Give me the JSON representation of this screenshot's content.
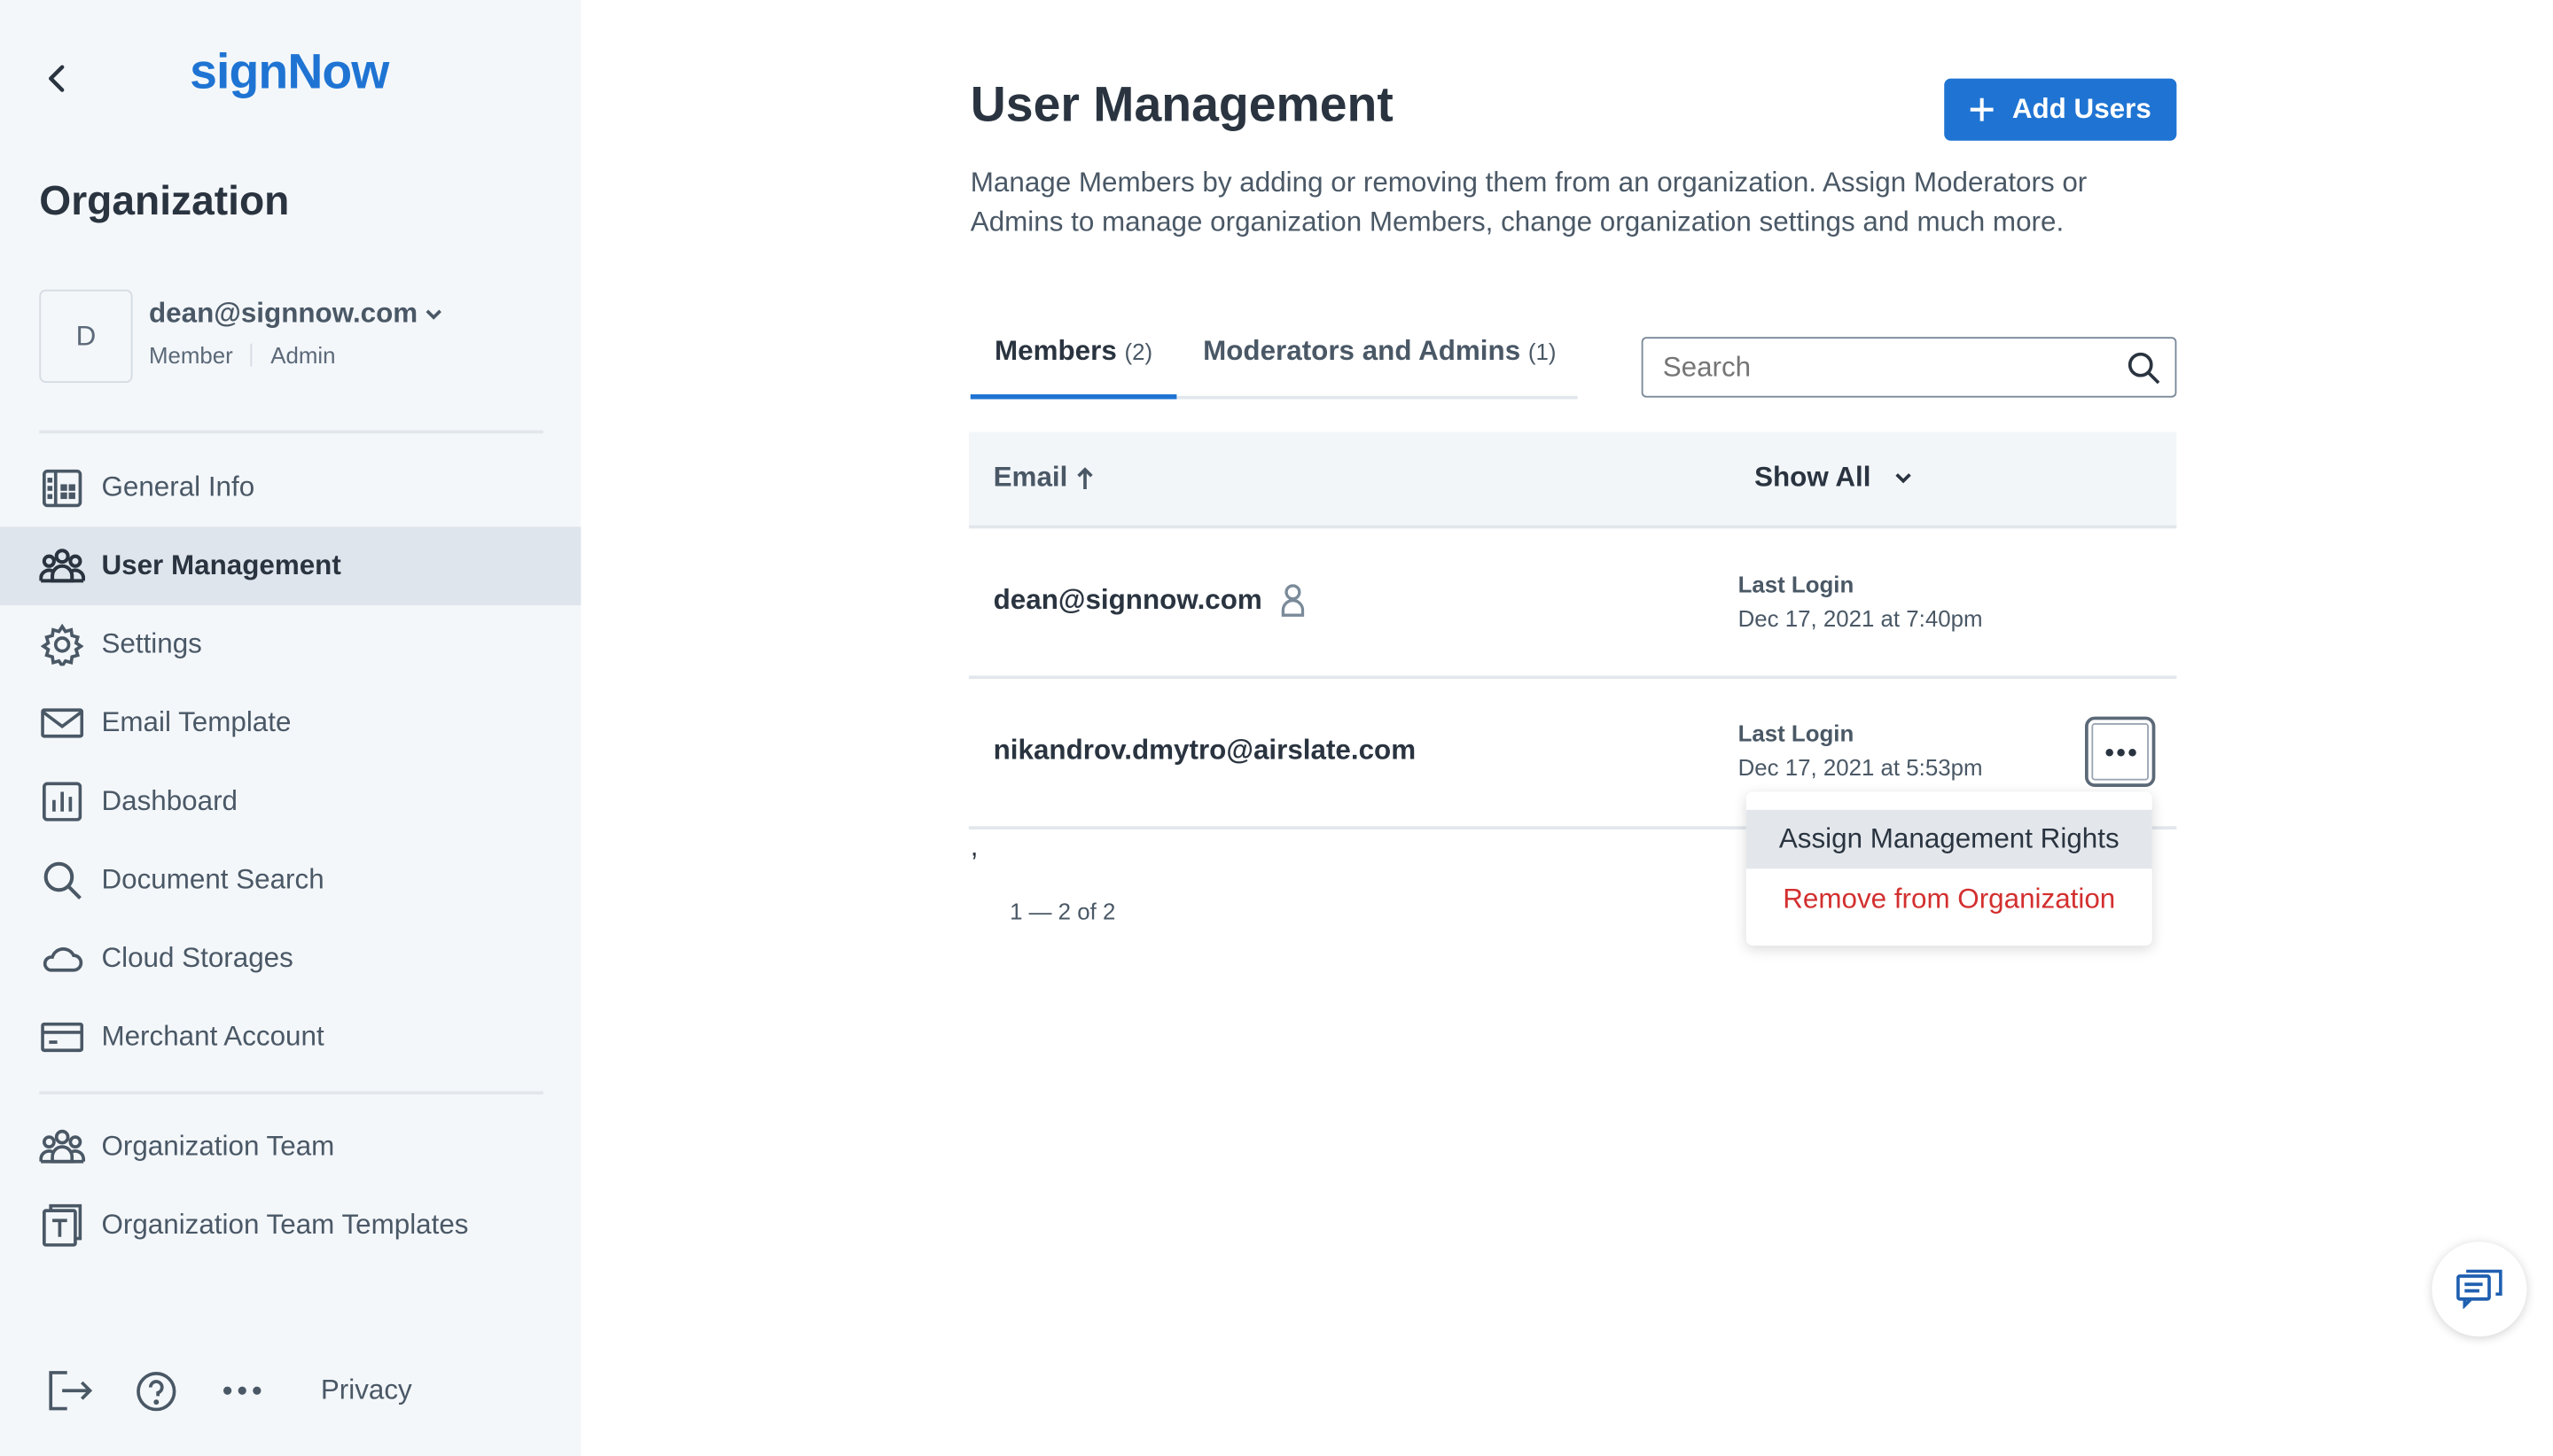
{
  "sidebar": {
    "logo": "signNow",
    "section_title": "Organization",
    "account": {
      "avatar_letter": "D",
      "email": "dean@signnow.com",
      "role_1": "Member",
      "role_2": "Admin"
    },
    "items": [
      {
        "label": "General Info",
        "icon": "building-icon"
      },
      {
        "label": "User Management",
        "icon": "users-icon",
        "active": true
      },
      {
        "label": "Settings",
        "icon": "gear-icon"
      },
      {
        "label": "Email Template",
        "icon": "envelope-icon"
      },
      {
        "label": "Dashboard",
        "icon": "bar-chart-icon"
      },
      {
        "label": "Document Search",
        "icon": "search-icon"
      },
      {
        "label": "Cloud Storages",
        "icon": "cloud-icon"
      },
      {
        "label": "Merchant Account",
        "icon": "credit-card-icon"
      }
    ],
    "team_items": [
      {
        "label": "Organization Team",
        "icon": "users-icon"
      },
      {
        "label": "Organization Team Templates",
        "icon": "template-icon"
      }
    ],
    "footer": {
      "privacy": "Privacy"
    }
  },
  "main": {
    "title": "User Management",
    "add_users": "Add Users",
    "description_line1": "Manage Members by adding or removing them from an organization. Assign Moderators or",
    "description_line2": "Admins to manage organization Members, change organization settings and much more.",
    "tabs": [
      {
        "label": "Members",
        "count": "(2)",
        "active": true
      },
      {
        "label": "Moderators and Admins",
        "count": "(1)"
      }
    ],
    "search": {
      "placeholder": "Search",
      "value": ""
    },
    "table": {
      "email_header": "Email",
      "filter": "Show All",
      "rows": [
        {
          "email": "dean@signnow.com",
          "login_label": "Last Login",
          "login_date": "Dec 17, 2021 at 7:40pm",
          "is_current_user": true
        },
        {
          "email": "nikandrov.dmytro@airslate.com",
          "login_label": "Last Login",
          "login_date": "Dec 17, 2021 at 5:53pm"
        }
      ]
    },
    "stray_text": ",",
    "pagination": "1 — 2 of 2",
    "menu": {
      "assign": "Assign Management Rights",
      "remove": "Remove from Organization"
    }
  },
  "colors": {
    "brand": "#1f74d3",
    "danger": "#d32f2f",
    "sidebar_bg": "#f4f7fa",
    "active_bg": "#dfe5ec"
  }
}
